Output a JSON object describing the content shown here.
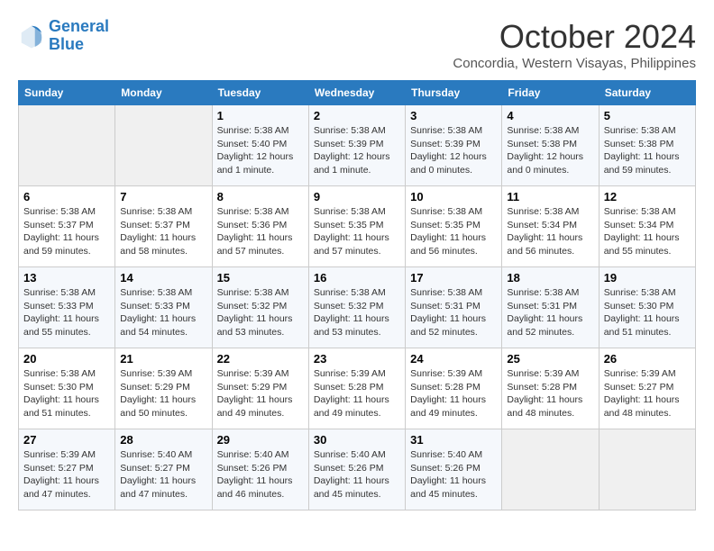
{
  "header": {
    "logo_line1": "General",
    "logo_line2": "Blue",
    "month": "October 2024",
    "location": "Concordia, Western Visayas, Philippines"
  },
  "days_of_week": [
    "Sunday",
    "Monday",
    "Tuesday",
    "Wednesday",
    "Thursday",
    "Friday",
    "Saturday"
  ],
  "weeks": [
    [
      {
        "day": "",
        "info": ""
      },
      {
        "day": "",
        "info": ""
      },
      {
        "day": "1",
        "info": "Sunrise: 5:38 AM\nSunset: 5:40 PM\nDaylight: 12 hours and 1 minute."
      },
      {
        "day": "2",
        "info": "Sunrise: 5:38 AM\nSunset: 5:39 PM\nDaylight: 12 hours and 1 minute."
      },
      {
        "day": "3",
        "info": "Sunrise: 5:38 AM\nSunset: 5:39 PM\nDaylight: 12 hours and 0 minutes."
      },
      {
        "day": "4",
        "info": "Sunrise: 5:38 AM\nSunset: 5:38 PM\nDaylight: 12 hours and 0 minutes."
      },
      {
        "day": "5",
        "info": "Sunrise: 5:38 AM\nSunset: 5:38 PM\nDaylight: 11 hours and 59 minutes."
      }
    ],
    [
      {
        "day": "6",
        "info": "Sunrise: 5:38 AM\nSunset: 5:37 PM\nDaylight: 11 hours and 59 minutes."
      },
      {
        "day": "7",
        "info": "Sunrise: 5:38 AM\nSunset: 5:37 PM\nDaylight: 11 hours and 58 minutes."
      },
      {
        "day": "8",
        "info": "Sunrise: 5:38 AM\nSunset: 5:36 PM\nDaylight: 11 hours and 57 minutes."
      },
      {
        "day": "9",
        "info": "Sunrise: 5:38 AM\nSunset: 5:35 PM\nDaylight: 11 hours and 57 minutes."
      },
      {
        "day": "10",
        "info": "Sunrise: 5:38 AM\nSunset: 5:35 PM\nDaylight: 11 hours and 56 minutes."
      },
      {
        "day": "11",
        "info": "Sunrise: 5:38 AM\nSunset: 5:34 PM\nDaylight: 11 hours and 56 minutes."
      },
      {
        "day": "12",
        "info": "Sunrise: 5:38 AM\nSunset: 5:34 PM\nDaylight: 11 hours and 55 minutes."
      }
    ],
    [
      {
        "day": "13",
        "info": "Sunrise: 5:38 AM\nSunset: 5:33 PM\nDaylight: 11 hours and 55 minutes."
      },
      {
        "day": "14",
        "info": "Sunrise: 5:38 AM\nSunset: 5:33 PM\nDaylight: 11 hours and 54 minutes."
      },
      {
        "day": "15",
        "info": "Sunrise: 5:38 AM\nSunset: 5:32 PM\nDaylight: 11 hours and 53 minutes."
      },
      {
        "day": "16",
        "info": "Sunrise: 5:38 AM\nSunset: 5:32 PM\nDaylight: 11 hours and 53 minutes."
      },
      {
        "day": "17",
        "info": "Sunrise: 5:38 AM\nSunset: 5:31 PM\nDaylight: 11 hours and 52 minutes."
      },
      {
        "day": "18",
        "info": "Sunrise: 5:38 AM\nSunset: 5:31 PM\nDaylight: 11 hours and 52 minutes."
      },
      {
        "day": "19",
        "info": "Sunrise: 5:38 AM\nSunset: 5:30 PM\nDaylight: 11 hours and 51 minutes."
      }
    ],
    [
      {
        "day": "20",
        "info": "Sunrise: 5:38 AM\nSunset: 5:30 PM\nDaylight: 11 hours and 51 minutes."
      },
      {
        "day": "21",
        "info": "Sunrise: 5:39 AM\nSunset: 5:29 PM\nDaylight: 11 hours and 50 minutes."
      },
      {
        "day": "22",
        "info": "Sunrise: 5:39 AM\nSunset: 5:29 PM\nDaylight: 11 hours and 49 minutes."
      },
      {
        "day": "23",
        "info": "Sunrise: 5:39 AM\nSunset: 5:28 PM\nDaylight: 11 hours and 49 minutes."
      },
      {
        "day": "24",
        "info": "Sunrise: 5:39 AM\nSunset: 5:28 PM\nDaylight: 11 hours and 49 minutes."
      },
      {
        "day": "25",
        "info": "Sunrise: 5:39 AM\nSunset: 5:28 PM\nDaylight: 11 hours and 48 minutes."
      },
      {
        "day": "26",
        "info": "Sunrise: 5:39 AM\nSunset: 5:27 PM\nDaylight: 11 hours and 48 minutes."
      }
    ],
    [
      {
        "day": "27",
        "info": "Sunrise: 5:39 AM\nSunset: 5:27 PM\nDaylight: 11 hours and 47 minutes."
      },
      {
        "day": "28",
        "info": "Sunrise: 5:40 AM\nSunset: 5:27 PM\nDaylight: 11 hours and 47 minutes."
      },
      {
        "day": "29",
        "info": "Sunrise: 5:40 AM\nSunset: 5:26 PM\nDaylight: 11 hours and 46 minutes."
      },
      {
        "day": "30",
        "info": "Sunrise: 5:40 AM\nSunset: 5:26 PM\nDaylight: 11 hours and 45 minutes."
      },
      {
        "day": "31",
        "info": "Sunrise: 5:40 AM\nSunset: 5:26 PM\nDaylight: 11 hours and 45 minutes."
      },
      {
        "day": "",
        "info": ""
      },
      {
        "day": "",
        "info": ""
      }
    ]
  ]
}
